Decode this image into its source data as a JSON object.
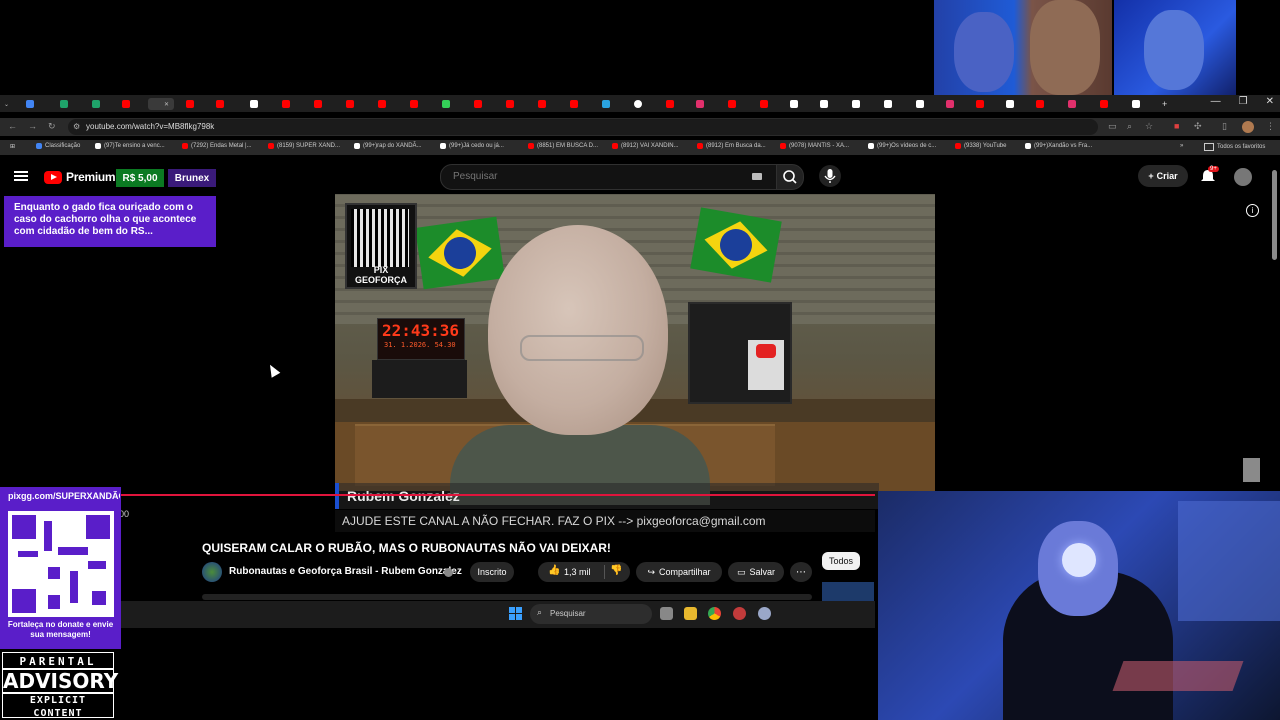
{
  "browser": {
    "url": "youtube.com/watch?v=MB8flkg798k",
    "window_controls": [
      "—",
      "❐",
      "✕"
    ],
    "bookmarks": [
      {
        "label": "Classificação",
        "color": "#4285f4"
      },
      {
        "label": "(97)Te ensino a venc...",
        "color": "#ffffff"
      },
      {
        "label": "(7292) Endas Metal |...",
        "color": "#ff0000"
      },
      {
        "label": "(8159) SUPER XAND...",
        "color": "#ff0000"
      },
      {
        "label": "(99+)rap do XANDÃ...",
        "color": "#ffffff"
      },
      {
        "label": "(99+)Já cedo ou já...",
        "color": "#ffffff"
      },
      {
        "label": "(8851) EM BUSCA D...",
        "color": "#ff0000"
      },
      {
        "label": "(8912) VAI XANDIN...",
        "color": "#ff0000"
      },
      {
        "label": "(8912) Em Busca da...",
        "color": "#ff0000"
      },
      {
        "label": "(9078) MANTIS - XA...",
        "color": "#ff0000"
      },
      {
        "label": "(99+)Os vídeos de c...",
        "color": "#ffffff"
      },
      {
        "label": "(9338) YouTube",
        "color": "#ff0000"
      },
      {
        "label": "(99+)Xandão vs Fra...",
        "color": "#ffffff"
      }
    ],
    "all_favorites": "Todos os favoritos"
  },
  "youtube": {
    "logo_text": "Premium",
    "logo_suffix": "BR",
    "price_badge": "R$ 5,00",
    "user_badge": "Brunex",
    "search_placeholder": "Pesquisar",
    "create_label": "Criar",
    "notif_count": "9+",
    "alert_text": "Enquanto o gado fica ouriçado com o caso do cachorro olha o que acontece com cidadão de bem do RS...",
    "video": {
      "qr_label": "PIX GEOFORÇA",
      "clock_time": "22:43:36",
      "clock_date": "31. 1.2026.   54.30",
      "lower_third_name": "Rubem Gonzalez",
      "pix_text": "AJUDE ESTE CANAL A NÃO FECHAR. FAZ O PIX --> pixgeoforca@gmail.com",
      "time_fragment": "00"
    },
    "title": "QUISERAM CALAR O RUBÃO, MAS O RUBONAUTAS NÃO VAI DEIXAR!",
    "channel": "Rubonautas e Geoforça Brasil - Rubem Gonzalez",
    "subscribe_label": "Inscrito",
    "likes": "1,3 mil",
    "share_label": "Compartilhar",
    "save_label": "Salvar",
    "chip_label": "Todos"
  },
  "taskbar": {
    "search_placeholder": "Pesquisar"
  },
  "overlay": {
    "qr_url": "pixgg.com/SUPERXANDÃO",
    "qr_message": "Fortaleça no donate e envie sua mensagem!",
    "advisory_top": "PARENTAL",
    "advisory_mid": "ADVISORY",
    "advisory_bottom": "EXPLICIT CONTENT"
  },
  "colors": {
    "accent_purple": "#5a1ec9",
    "youtube_red": "#ff0000",
    "progress_red": "#e0143c",
    "price_green": "#0b7a22"
  }
}
